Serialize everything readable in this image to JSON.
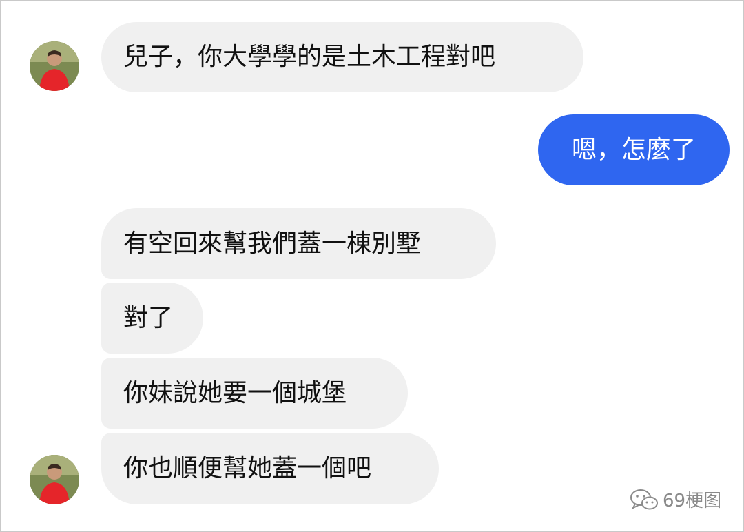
{
  "chat": {
    "messages": [
      {
        "sender": "mom",
        "text": "兒子，你大學學的是土木工程對吧"
      },
      {
        "sender": "me",
        "text": "嗯，怎麼了"
      },
      {
        "sender": "mom",
        "text": "有空回來幫我們蓋一棟別墅"
      },
      {
        "sender": "mom",
        "text": "對了"
      },
      {
        "sender": "mom",
        "text": "你妹說她要一個城堡"
      },
      {
        "sender": "mom",
        "text": "你也順便幫她蓋一個吧"
      }
    ]
  },
  "watermark": {
    "label": "69梗图",
    "icon": "wechat-icon"
  },
  "colors": {
    "incoming_bubble": "#f0f0f0",
    "outgoing_bubble": "#2f66f0",
    "outgoing_text": "#ffffff"
  }
}
